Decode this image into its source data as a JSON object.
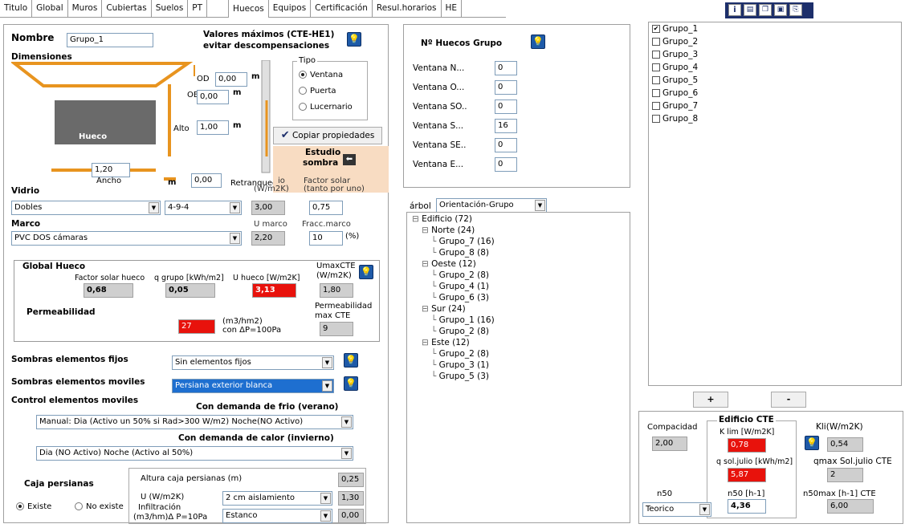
{
  "tabs": [
    "Titulo",
    "Global",
    "Muros",
    "Cubiertas",
    "Suelos",
    "PT",
    "Huecos",
    "Equipos",
    "Certificación",
    "Resul.horarios",
    "HE"
  ],
  "active_tab": "Huecos",
  "toolbar_icons": [
    "info-icon",
    "doc-icon",
    "copy-icon",
    "save-icon",
    "paste-icon"
  ],
  "nombre": {
    "label": "Nombre",
    "value": "Grupo_1"
  },
  "valores_maximos": {
    "line1": "Valores máximos (CTE-HE1)",
    "line2": "evitar descompensaciones"
  },
  "dimensiones": {
    "label": "Dimensiones",
    "od_label": "OD",
    "od_value": "0,00",
    "od_unit": "m",
    "ob_label": "OB",
    "ob_value": "0,00",
    "ob_unit": "m",
    "alto_label": "Alto",
    "alto_value": "1,00",
    "alto_unit": "m",
    "ancho_label": "Ancho",
    "ancho_value": "1,20",
    "ancho_unit": "m",
    "retranqueo_label": "Retranqueo",
    "retranqueo_value": "0,00",
    "hueco_label": "Hueco"
  },
  "tipo": {
    "label": "Tipo",
    "options": [
      "Ventana",
      "Puerta",
      "Lucernario"
    ],
    "selected": "Ventana"
  },
  "copiar_label": "Copiar propiedades",
  "estudio_sombra": {
    "line1": "Estudio",
    "line2": "sombra"
  },
  "vidrio": {
    "label": "Vidrio",
    "u_label_1": "io",
    "u_label_2": "(W/m2K)",
    "factor_solar_label_1": "Factor solar",
    "factor_solar_label_2": "(tanto por uno)",
    "type": "Dobles",
    "composition": "4-9-4",
    "u_value": "3,00",
    "factor_solar": "0,75"
  },
  "marco": {
    "label": "Marco",
    "u_label": "U marco",
    "fracc_label": "Fracc.marco",
    "type": "PVC DOS cámaras",
    "u_value": "2,20",
    "fracc_value": "10",
    "fracc_unit": "(%)"
  },
  "global_hueco": {
    "label": "Global Hueco",
    "factor_solar_label": "Factor solar hueco",
    "factor_solar_value": "0,68",
    "q_grupo_label": "q grupo [kWh/m2]",
    "q_grupo_value": "0,05",
    "u_hueco_label": "U hueco [W/m2K]",
    "u_hueco_value": "3,13",
    "umax_label_1": "UmaxCTE",
    "umax_label_2": "(W/m2K)",
    "umax_value": "1,80",
    "permeabilidad_label": "Permeabilidad",
    "permeabilidad_value": "27",
    "perm_unit_1": "(m3/hm2)",
    "perm_unit_2": "con ΔP=100Pa",
    "perm_max_label_1": "Permeabilidad",
    "perm_max_label_2": "max CTE",
    "perm_max_value": "9"
  },
  "sombras_fijos": {
    "label": "Sombras elementos fijos",
    "value": "Sin elementos fijos"
  },
  "sombras_moviles": {
    "label": "Sombras elementos moviles",
    "value": "Persiana exterior blanca"
  },
  "control": {
    "label": "Control elementos moviles",
    "frio_label": "Con demanda de frio (verano)",
    "frio_value": "Manual: Dia (Activo un 50% si Rad>300 W/m2) Noche(NO Activo)",
    "calor_label": "Con demanda de calor (invierno)",
    "calor_value": "Dia (NO Activo) Noche (Activo al 50%)"
  },
  "caja_persianas": {
    "label": "Caja persianas",
    "existe": "Existe",
    "no_existe": "No existe",
    "selected": "Existe",
    "altura_label": "Altura caja persianas (m)",
    "altura_value": "0,25",
    "u_label": "U (W/m2K)",
    "u_type": "2 cm aislamiento",
    "u_value": "1,30",
    "infil_label_1": "Infiltración",
    "infil_label_2": "(m3/hm)Δ P=10Pa",
    "infil_type": "Estanco",
    "infil_value": "0,00"
  },
  "num_huecos": {
    "title": "Nº Huecos Grupo",
    "rows": [
      {
        "label": "Ventana N...",
        "value": "0"
      },
      {
        "label": "Ventana O...",
        "value": "0"
      },
      {
        "label": "Ventana SO..",
        "value": "0"
      },
      {
        "label": "Ventana S...",
        "value": "16"
      },
      {
        "label": "Ventana SE..",
        "value": "0"
      },
      {
        "label": "Ventana E...",
        "value": "0"
      }
    ]
  },
  "arbol": {
    "label": "árbol",
    "mode": "Orientación-Grupo"
  },
  "tree": [
    {
      "text": "Edificio  (72)",
      "level": 0,
      "box": "⊟"
    },
    {
      "text": "Norte  (24)",
      "level": 1,
      "box": "⊟"
    },
    {
      "text": "Grupo_7  (16)",
      "level": 2,
      "box": ""
    },
    {
      "text": "Grupo_8  (8)",
      "level": 2,
      "box": ""
    },
    {
      "text": "Oeste  (12)",
      "level": 1,
      "box": "⊟"
    },
    {
      "text": "Grupo_2  (8)",
      "level": 2,
      "box": ""
    },
    {
      "text": "Grupo_4  (1)",
      "level": 2,
      "box": ""
    },
    {
      "text": "Grupo_6  (3)",
      "level": 2,
      "box": ""
    },
    {
      "text": "Sur  (24)",
      "level": 1,
      "box": "⊟"
    },
    {
      "text": "Grupo_1  (16)",
      "level": 2,
      "box": ""
    },
    {
      "text": "Grupo_2  (8)",
      "level": 2,
      "box": ""
    },
    {
      "text": "Este  (12)",
      "level": 1,
      "box": "⊟"
    },
    {
      "text": "Grupo_2  (8)",
      "level": 2,
      "box": ""
    },
    {
      "text": "Grupo_3  (1)",
      "level": 2,
      "box": ""
    },
    {
      "text": "Grupo_5  (3)",
      "level": 2,
      "box": ""
    }
  ],
  "grupos": [
    {
      "name": "Grupo_1",
      "checked": true
    },
    {
      "name": "Grupo_2",
      "checked": false
    },
    {
      "name": "Grupo_3",
      "checked": false
    },
    {
      "name": "Grupo_4",
      "checked": false
    },
    {
      "name": "Grupo_5",
      "checked": false
    },
    {
      "name": "Grupo_6",
      "checked": false
    },
    {
      "name": "Grupo_7",
      "checked": false
    },
    {
      "name": "Grupo_8",
      "checked": false
    }
  ],
  "add_label": "+",
  "remove_label": "-",
  "edificio_cte": {
    "title": "Edificio CTE",
    "compacidad_label": "Compacidad",
    "compacidad_value": "2,00",
    "klim_label": "K lim [W/m2K]",
    "klim_value": "0,78",
    "kli_label": "Kli(W/m2K)",
    "kli_value": "0,54",
    "qsol_label": "q sol.julio [kWh/m2]",
    "qsol_value": "5,87",
    "qmax_label": "qmax Sol.julio CTE",
    "qmax_value": "2",
    "n50_label": "n50",
    "n50_mode": "Teorico",
    "n50h_label": "n50 [h-1]",
    "n50h_value": "4,36",
    "n50max_label": "n50max [h-1]  CTE",
    "n50max_value": "6,00"
  },
  "colors": {
    "accent": "#1e5aa8",
    "alert": "#e8120c",
    "readonly": "#cfcfcf",
    "orange": "#e8941f",
    "sombra_bg": "#f8dcc2"
  }
}
